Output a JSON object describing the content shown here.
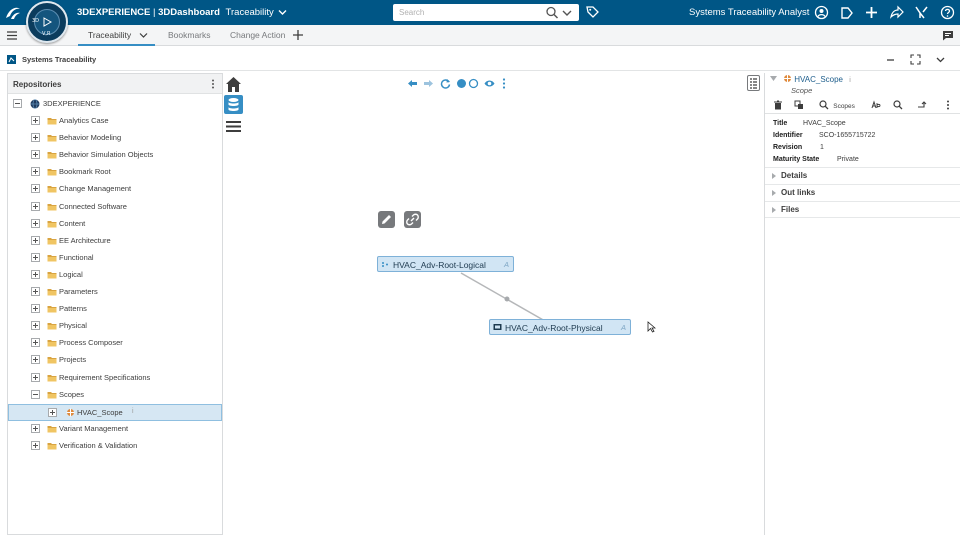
{
  "topbar": {
    "brand_3dx": "3DEXPERIENCE",
    "separator": " | ",
    "brand_dashboard": "3DDashboard",
    "dashboard_name": "Traceability",
    "compass_top": "3D",
    "compass_v": "V,R",
    "search_placeholder": "Search",
    "user_role": "Systems Traceability Analyst",
    "color_bg": "#005686"
  },
  "tabs": [
    {
      "label": "Traceability",
      "active": true
    },
    {
      "label": "Bookmarks",
      "active": false
    },
    {
      "label": "Change Action",
      "active": false
    }
  ],
  "widget": {
    "title": "Systems Traceability"
  },
  "repositories": {
    "title": "Repositories",
    "root": "3DEXPERIENCE",
    "items": [
      {
        "label": "Analytics Case",
        "expanded": false
      },
      {
        "label": "Behavior Modeling",
        "expanded": false
      },
      {
        "label": "Behavior Simulation Objects",
        "expanded": false
      },
      {
        "label": "Bookmark Root",
        "expanded": false
      },
      {
        "label": "Change Management",
        "expanded": false
      },
      {
        "label": "Connected Software",
        "expanded": false
      },
      {
        "label": "Content",
        "expanded": false
      },
      {
        "label": "EE Architecture",
        "expanded": false
      },
      {
        "label": "Functional",
        "expanded": false
      },
      {
        "label": "Logical",
        "expanded": false
      },
      {
        "label": "Parameters",
        "expanded": false
      },
      {
        "label": "Patterns",
        "expanded": false
      },
      {
        "label": "Physical",
        "expanded": false
      },
      {
        "label": "Process Composer",
        "expanded": false
      },
      {
        "label": "Projects",
        "expanded": false
      },
      {
        "label": "Requirement Specifications",
        "expanded": false
      },
      {
        "label": "Scopes",
        "expanded": true
      },
      {
        "label": "Variant Management",
        "expanded": false
      },
      {
        "label": "Verification & Validation",
        "expanded": false
      }
    ],
    "child": {
      "label": "HVAC_Scope",
      "info": "i"
    }
  },
  "graph": {
    "nodes": [
      {
        "label": "HVAC_Adv-Root-Logical",
        "tag": "A"
      },
      {
        "label": "HVAC_Adv-Root-Physical",
        "tag": "A"
      }
    ]
  },
  "properties": {
    "object_name": "HVAC_Scope",
    "object_info": "i",
    "object_type": "Scope",
    "toolbar_scopes_label": "Scopes",
    "attributes": [
      {
        "label": "Title",
        "value": "HVAC_Scope"
      },
      {
        "label": "Identifier",
        "value": "SCO-1655715722"
      },
      {
        "label": "Revision",
        "value": "1"
      },
      {
        "label": "Maturity State",
        "value": "Private"
      }
    ],
    "sections": [
      "Details",
      "Out links",
      "Files"
    ]
  }
}
